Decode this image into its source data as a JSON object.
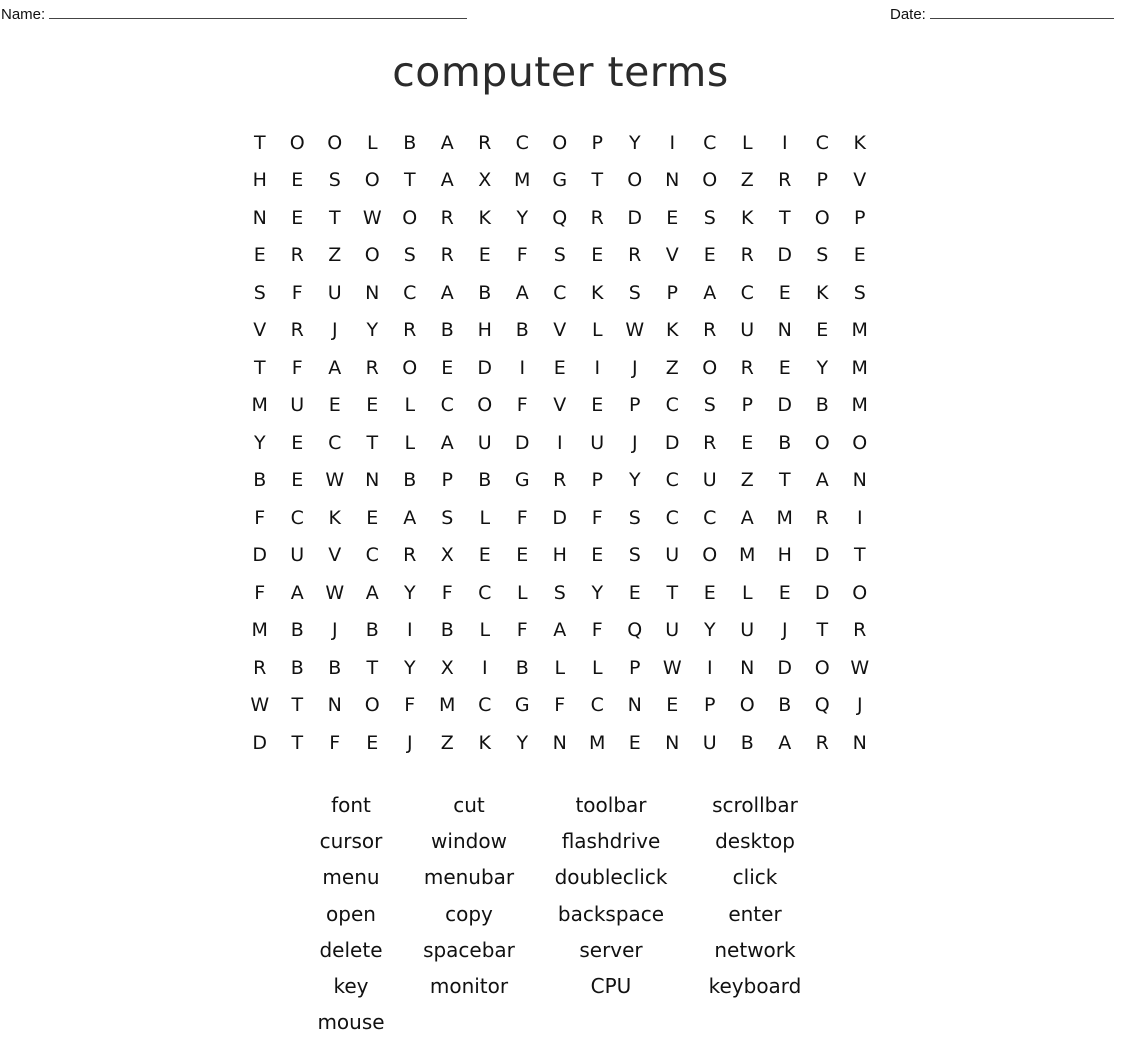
{
  "header": {
    "name_label": "Name:",
    "date_label": "Date:"
  },
  "title": "computer terms",
  "grid": [
    [
      "T",
      "O",
      "O",
      "L",
      "B",
      "A",
      "R",
      "C",
      "O",
      "P",
      "Y",
      "I",
      "C",
      "L",
      "I",
      "C",
      "K"
    ],
    [
      "H",
      "E",
      "S",
      "O",
      "T",
      "A",
      "X",
      "M",
      "G",
      "T",
      "O",
      "N",
      "O",
      "Z",
      "R",
      "P",
      "V"
    ],
    [
      "N",
      "E",
      "T",
      "W",
      "O",
      "R",
      "K",
      "Y",
      "Q",
      "R",
      "D",
      "E",
      "S",
      "K",
      "T",
      "O",
      "P"
    ],
    [
      "E",
      "R",
      "Z",
      "O",
      "S",
      "R",
      "E",
      "F",
      "S",
      "E",
      "R",
      "V",
      "E",
      "R",
      "D",
      "S",
      "E"
    ],
    [
      "S",
      "F",
      "U",
      "N",
      "C",
      "A",
      "B",
      "A",
      "C",
      "K",
      "S",
      "P",
      "A",
      "C",
      "E",
      "K",
      "S"
    ],
    [
      "V",
      "R",
      "J",
      "Y",
      "R",
      "B",
      "H",
      "B",
      "V",
      "L",
      "W",
      "K",
      "R",
      "U",
      "N",
      "E",
      "M"
    ],
    [
      "T",
      "F",
      "A",
      "R",
      "O",
      "E",
      "D",
      "I",
      "E",
      "I",
      "J",
      "Z",
      "O",
      "R",
      "E",
      "Y",
      "M"
    ],
    [
      "M",
      "U",
      "E",
      "E",
      "L",
      "C",
      "O",
      "F",
      "V",
      "E",
      "P",
      "C",
      "S",
      "P",
      "D",
      "B",
      "M"
    ],
    [
      "Y",
      "E",
      "C",
      "T",
      "L",
      "A",
      "U",
      "D",
      "I",
      "U",
      "J",
      "D",
      "R",
      "E",
      "B",
      "O",
      "O"
    ],
    [
      "B",
      "E",
      "W",
      "N",
      "B",
      "P",
      "B",
      "G",
      "R",
      "P",
      "Y",
      "C",
      "U",
      "Z",
      "T",
      "A",
      "N"
    ],
    [
      "F",
      "C",
      "K",
      "E",
      "A",
      "S",
      "L",
      "F",
      "D",
      "F",
      "S",
      "C",
      "C",
      "A",
      "M",
      "R",
      "I"
    ],
    [
      "D",
      "U",
      "V",
      "C",
      "R",
      "X",
      "E",
      "E",
      "H",
      "E",
      "S",
      "U",
      "O",
      "M",
      "H",
      "D",
      "T"
    ],
    [
      "F",
      "A",
      "W",
      "A",
      "Y",
      "F",
      "C",
      "L",
      "S",
      "Y",
      "E",
      "T",
      "E",
      "L",
      "E",
      "D",
      "O"
    ],
    [
      "M",
      "B",
      "J",
      "B",
      "I",
      "B",
      "L",
      "F",
      "A",
      "F",
      "Q",
      "U",
      "Y",
      "U",
      "J",
      "T",
      "R"
    ],
    [
      "R",
      "B",
      "B",
      "T",
      "Y",
      "X",
      "I",
      "B",
      "L",
      "L",
      "P",
      "W",
      "I",
      "N",
      "D",
      "O",
      "W"
    ],
    [
      "W",
      "T",
      "N",
      "O",
      "F",
      "M",
      "C",
      "G",
      "F",
      "C",
      "N",
      "E",
      "P",
      "O",
      "B",
      "Q",
      "J"
    ],
    [
      "D",
      "T",
      "F",
      "E",
      "J",
      "Z",
      "K",
      "Y",
      "N",
      "M",
      "E",
      "N",
      "U",
      "B",
      "A",
      "R",
      "N"
    ]
  ],
  "word_list": [
    "font",
    "cut",
    "toolbar",
    "scrollbar",
    "cursor",
    "window",
    "flashdrive",
    "desktop",
    "menu",
    "menubar",
    "doubleclick",
    "click",
    "open",
    "copy",
    "backspace",
    "enter",
    "delete",
    "spacebar",
    "server",
    "network",
    "key",
    "monitor",
    "CPU",
    "keyboard",
    "mouse"
  ]
}
